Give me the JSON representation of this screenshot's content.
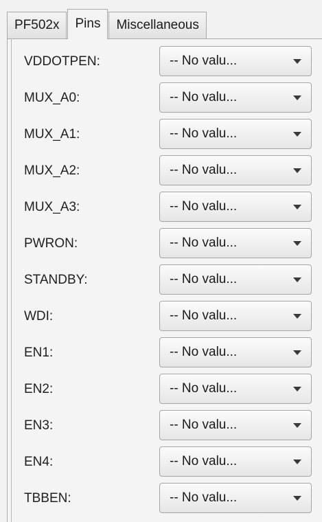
{
  "tabs": [
    {
      "label": "PF502x",
      "active": false
    },
    {
      "label": "Pins",
      "active": true
    },
    {
      "label": "Miscellaneous",
      "active": false
    }
  ],
  "pins": [
    {
      "label": "VDDOTPEN:",
      "value": "-- No valu..."
    },
    {
      "label": "MUX_A0:",
      "value": "-- No valu..."
    },
    {
      "label": "MUX_A1:",
      "value": "-- No valu..."
    },
    {
      "label": "MUX_A2:",
      "value": "-- No valu..."
    },
    {
      "label": "MUX_A3:",
      "value": "-- No valu..."
    },
    {
      "label": "PWRON:",
      "value": "-- No valu..."
    },
    {
      "label": "STANDBY:",
      "value": "-- No valu..."
    },
    {
      "label": "WDI:",
      "value": "-- No valu..."
    },
    {
      "label": "EN1:",
      "value": "-- No valu..."
    },
    {
      "label": "EN2:",
      "value": "-- No valu..."
    },
    {
      "label": "EN3:",
      "value": "-- No valu..."
    },
    {
      "label": "EN4:",
      "value": "-- No valu..."
    },
    {
      "label": "TBBEN:",
      "value": "-- No valu..."
    }
  ]
}
